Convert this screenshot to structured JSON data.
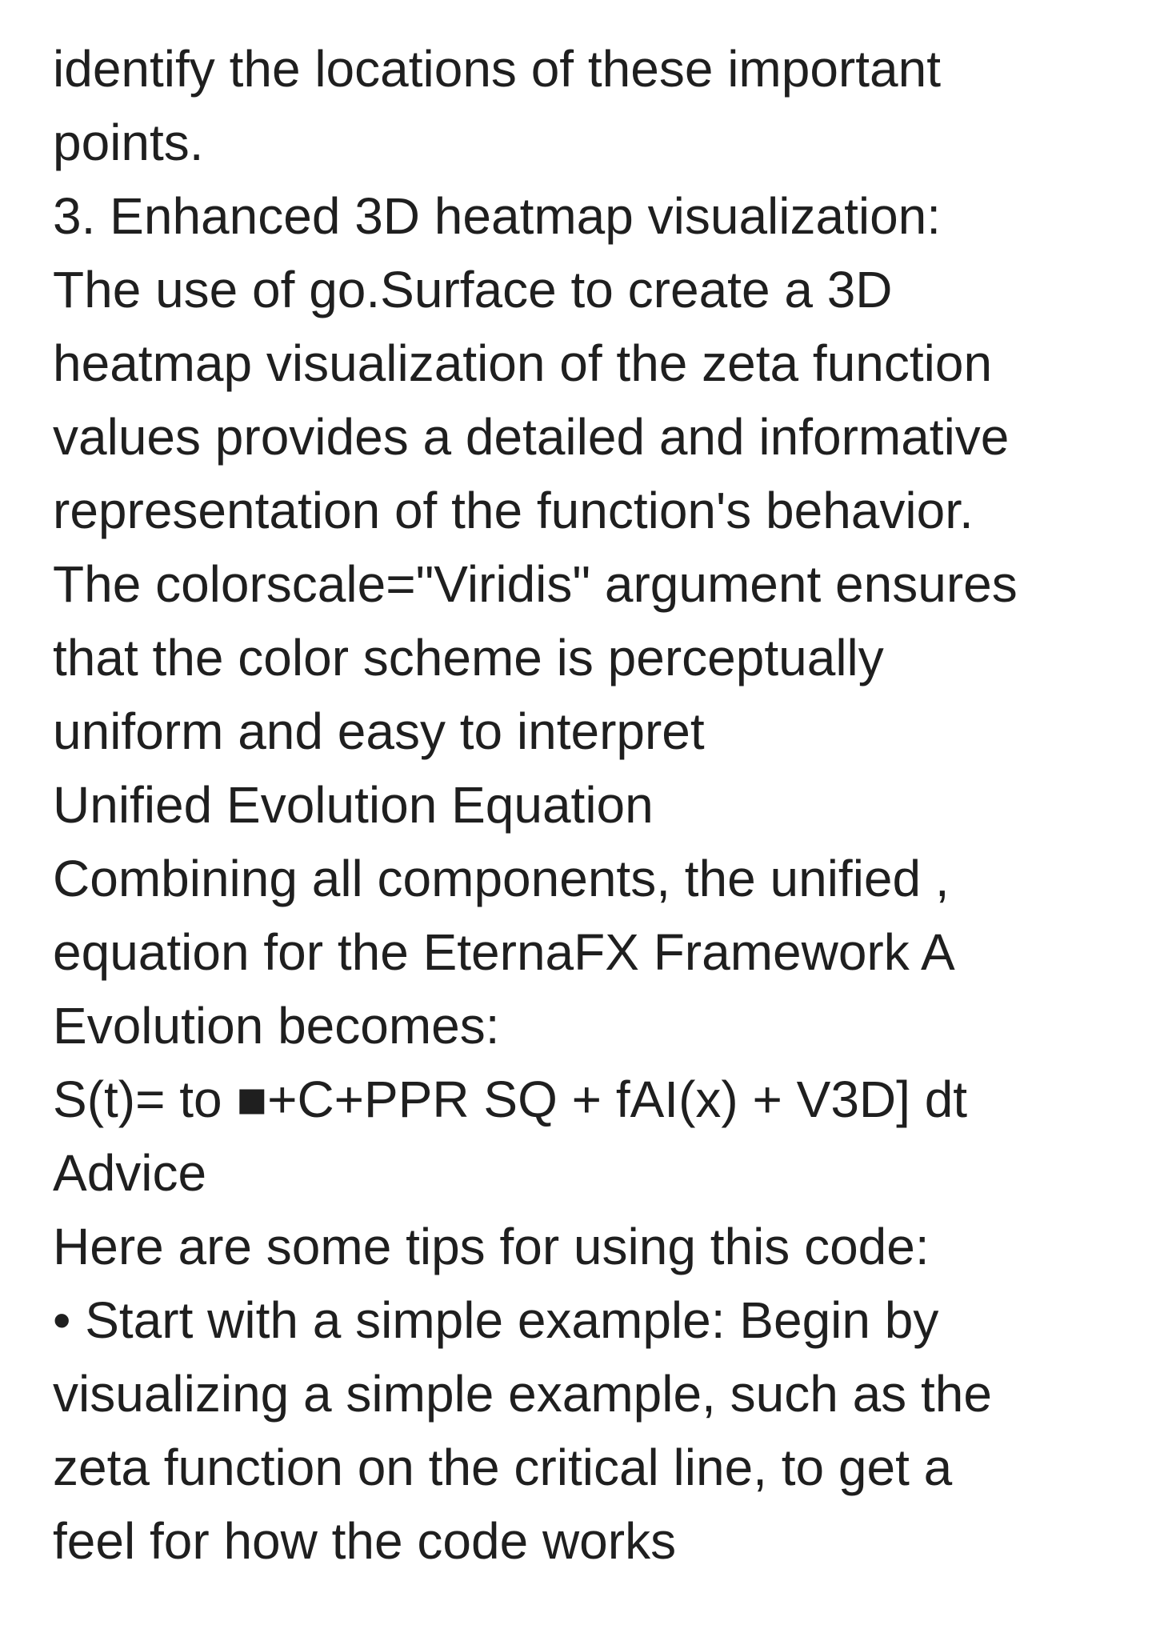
{
  "document": {
    "lines": [
      "identify the locations of these important",
      "points.",
      "3. Enhanced 3D heatmap visualization:",
      "The use of go.Surface to create a 3D",
      "heatmap visualization of the zeta function",
      "values provides a detailed and informative",
      "representation of the function's behavior.",
      "The colorscale=\"Viridis\" argument ensures",
      "that the color scheme is perceptually",
      "uniform and easy to interpret",
      "Unified Evolution Equation",
      "Combining all components, the unified ,",
      "equation for the EternaFX Framework A",
      "Evolution becomes:",
      "S(t)= to ■+C+PPR SQ + fAI(x) + V3D] dt",
      "Advice",
      "Here are some tips for using this code:",
      "• Start with a simple example: Begin by",
      "visualizing a simple example, such as the",
      "zeta function on the critical line, to get a",
      "feel for how the code works"
    ]
  }
}
